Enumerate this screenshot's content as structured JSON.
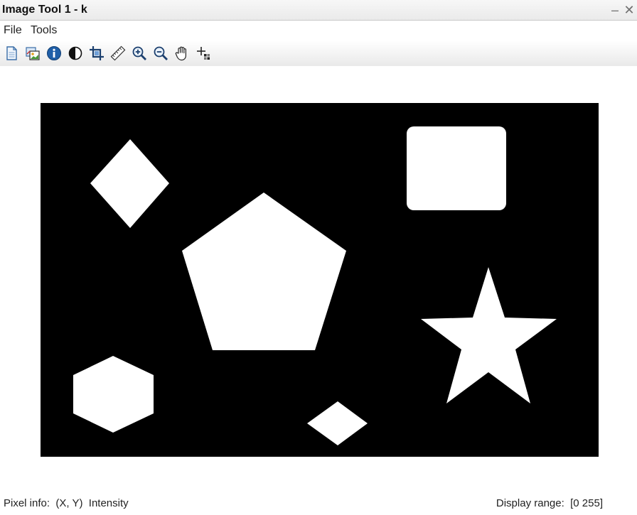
{
  "window": {
    "title": "Image Tool 1 - k",
    "minimize_glyph": "–",
    "close_glyph": "✕"
  },
  "menu": {
    "items": [
      "File",
      "Tools"
    ]
  },
  "toolbar": {
    "tools": [
      {
        "icon": "new-document-icon",
        "tooltip": ""
      },
      {
        "icon": "image-viewer-icon",
        "tooltip": ""
      },
      {
        "icon": "info-icon",
        "tooltip": ""
      },
      {
        "icon": "contrast-icon",
        "tooltip": ""
      },
      {
        "icon": "crop-icon",
        "tooltip": ""
      },
      {
        "icon": "ruler-icon",
        "tooltip": ""
      },
      {
        "icon": "zoom-in-icon",
        "tooltip": ""
      },
      {
        "icon": "zoom-out-icon",
        "tooltip": ""
      },
      {
        "icon": "pan-hand-icon",
        "tooltip": ""
      },
      {
        "icon": "pixel-region-icon",
        "tooltip": ""
      }
    ]
  },
  "image": {
    "background_color": "#000000",
    "shape_color": "#ffffff",
    "shapes": [
      "diamond",
      "rounded-rectangle",
      "pentagon",
      "star",
      "hexagon",
      "small-diamond"
    ]
  },
  "status": {
    "pixel_info_label": "Pixel info:",
    "pixel_info_value": "(X, Y)  Intensity",
    "display_range_label": "Display range:",
    "display_range_value": "[0 255]"
  }
}
